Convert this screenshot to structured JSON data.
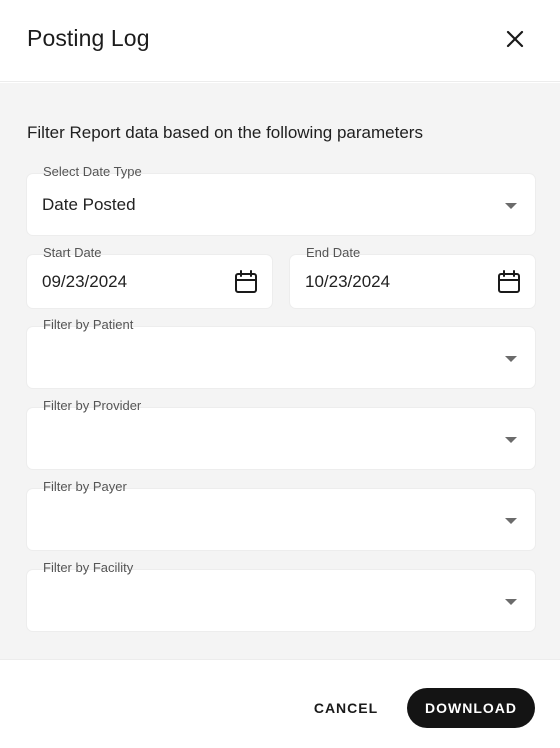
{
  "dialog": {
    "title": "Posting Log",
    "close_icon": "close-icon"
  },
  "filters": {
    "description": "Filter Report data based on the following parameters",
    "date_type": {
      "label": "Select Date Type",
      "value": "Date Posted"
    },
    "start_date": {
      "label": "Start Date",
      "value": "09/23/2024",
      "icon": "calendar-icon"
    },
    "end_date": {
      "label": "End Date",
      "value": "10/23/2024",
      "icon": "calendar-icon"
    },
    "patient": {
      "label": "Filter by Patient",
      "value": ""
    },
    "provider": {
      "label": "Filter by Provider",
      "value": ""
    },
    "payer": {
      "label": "Filter by Payer",
      "value": ""
    },
    "facility": {
      "label": "Filter by Facility",
      "value": ""
    }
  },
  "actions": {
    "cancel_label": "CANCEL",
    "download_label": "DOWNLOAD"
  },
  "colors": {
    "background": "#f4f4f4",
    "surface": "#ffffff",
    "primary_button": "#141414"
  }
}
